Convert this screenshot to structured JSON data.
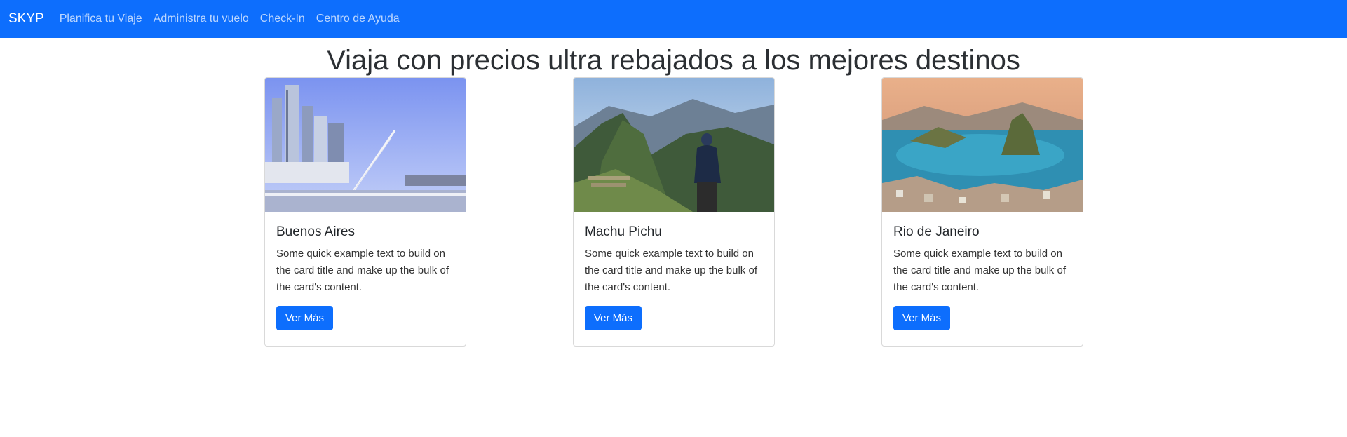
{
  "navbar": {
    "brand": "SKYP",
    "links": [
      "Planifica tu Viaje",
      "Administra tu vuelo",
      "Check-In",
      "Centro de Ayuda"
    ],
    "bg_color": "#0d6efd"
  },
  "hero": {
    "title": "Viaja con precios ultra rebajados a los mejores destinos"
  },
  "cards": [
    {
      "title": "Buenos Aires",
      "text": "Some quick example text to build on the card title and make up the bulk of the card's content.",
      "button": "Ver Más"
    },
    {
      "title": "Machu Pichu",
      "text": "Some quick example text to build on the card title and make up the bulk of the card's content.",
      "button": "Ver Más"
    },
    {
      "title": "Rio de Janeiro",
      "text": "Some quick example text to build on the card title and make up the bulk of the card's content.",
      "button": "Ver Más"
    }
  ]
}
